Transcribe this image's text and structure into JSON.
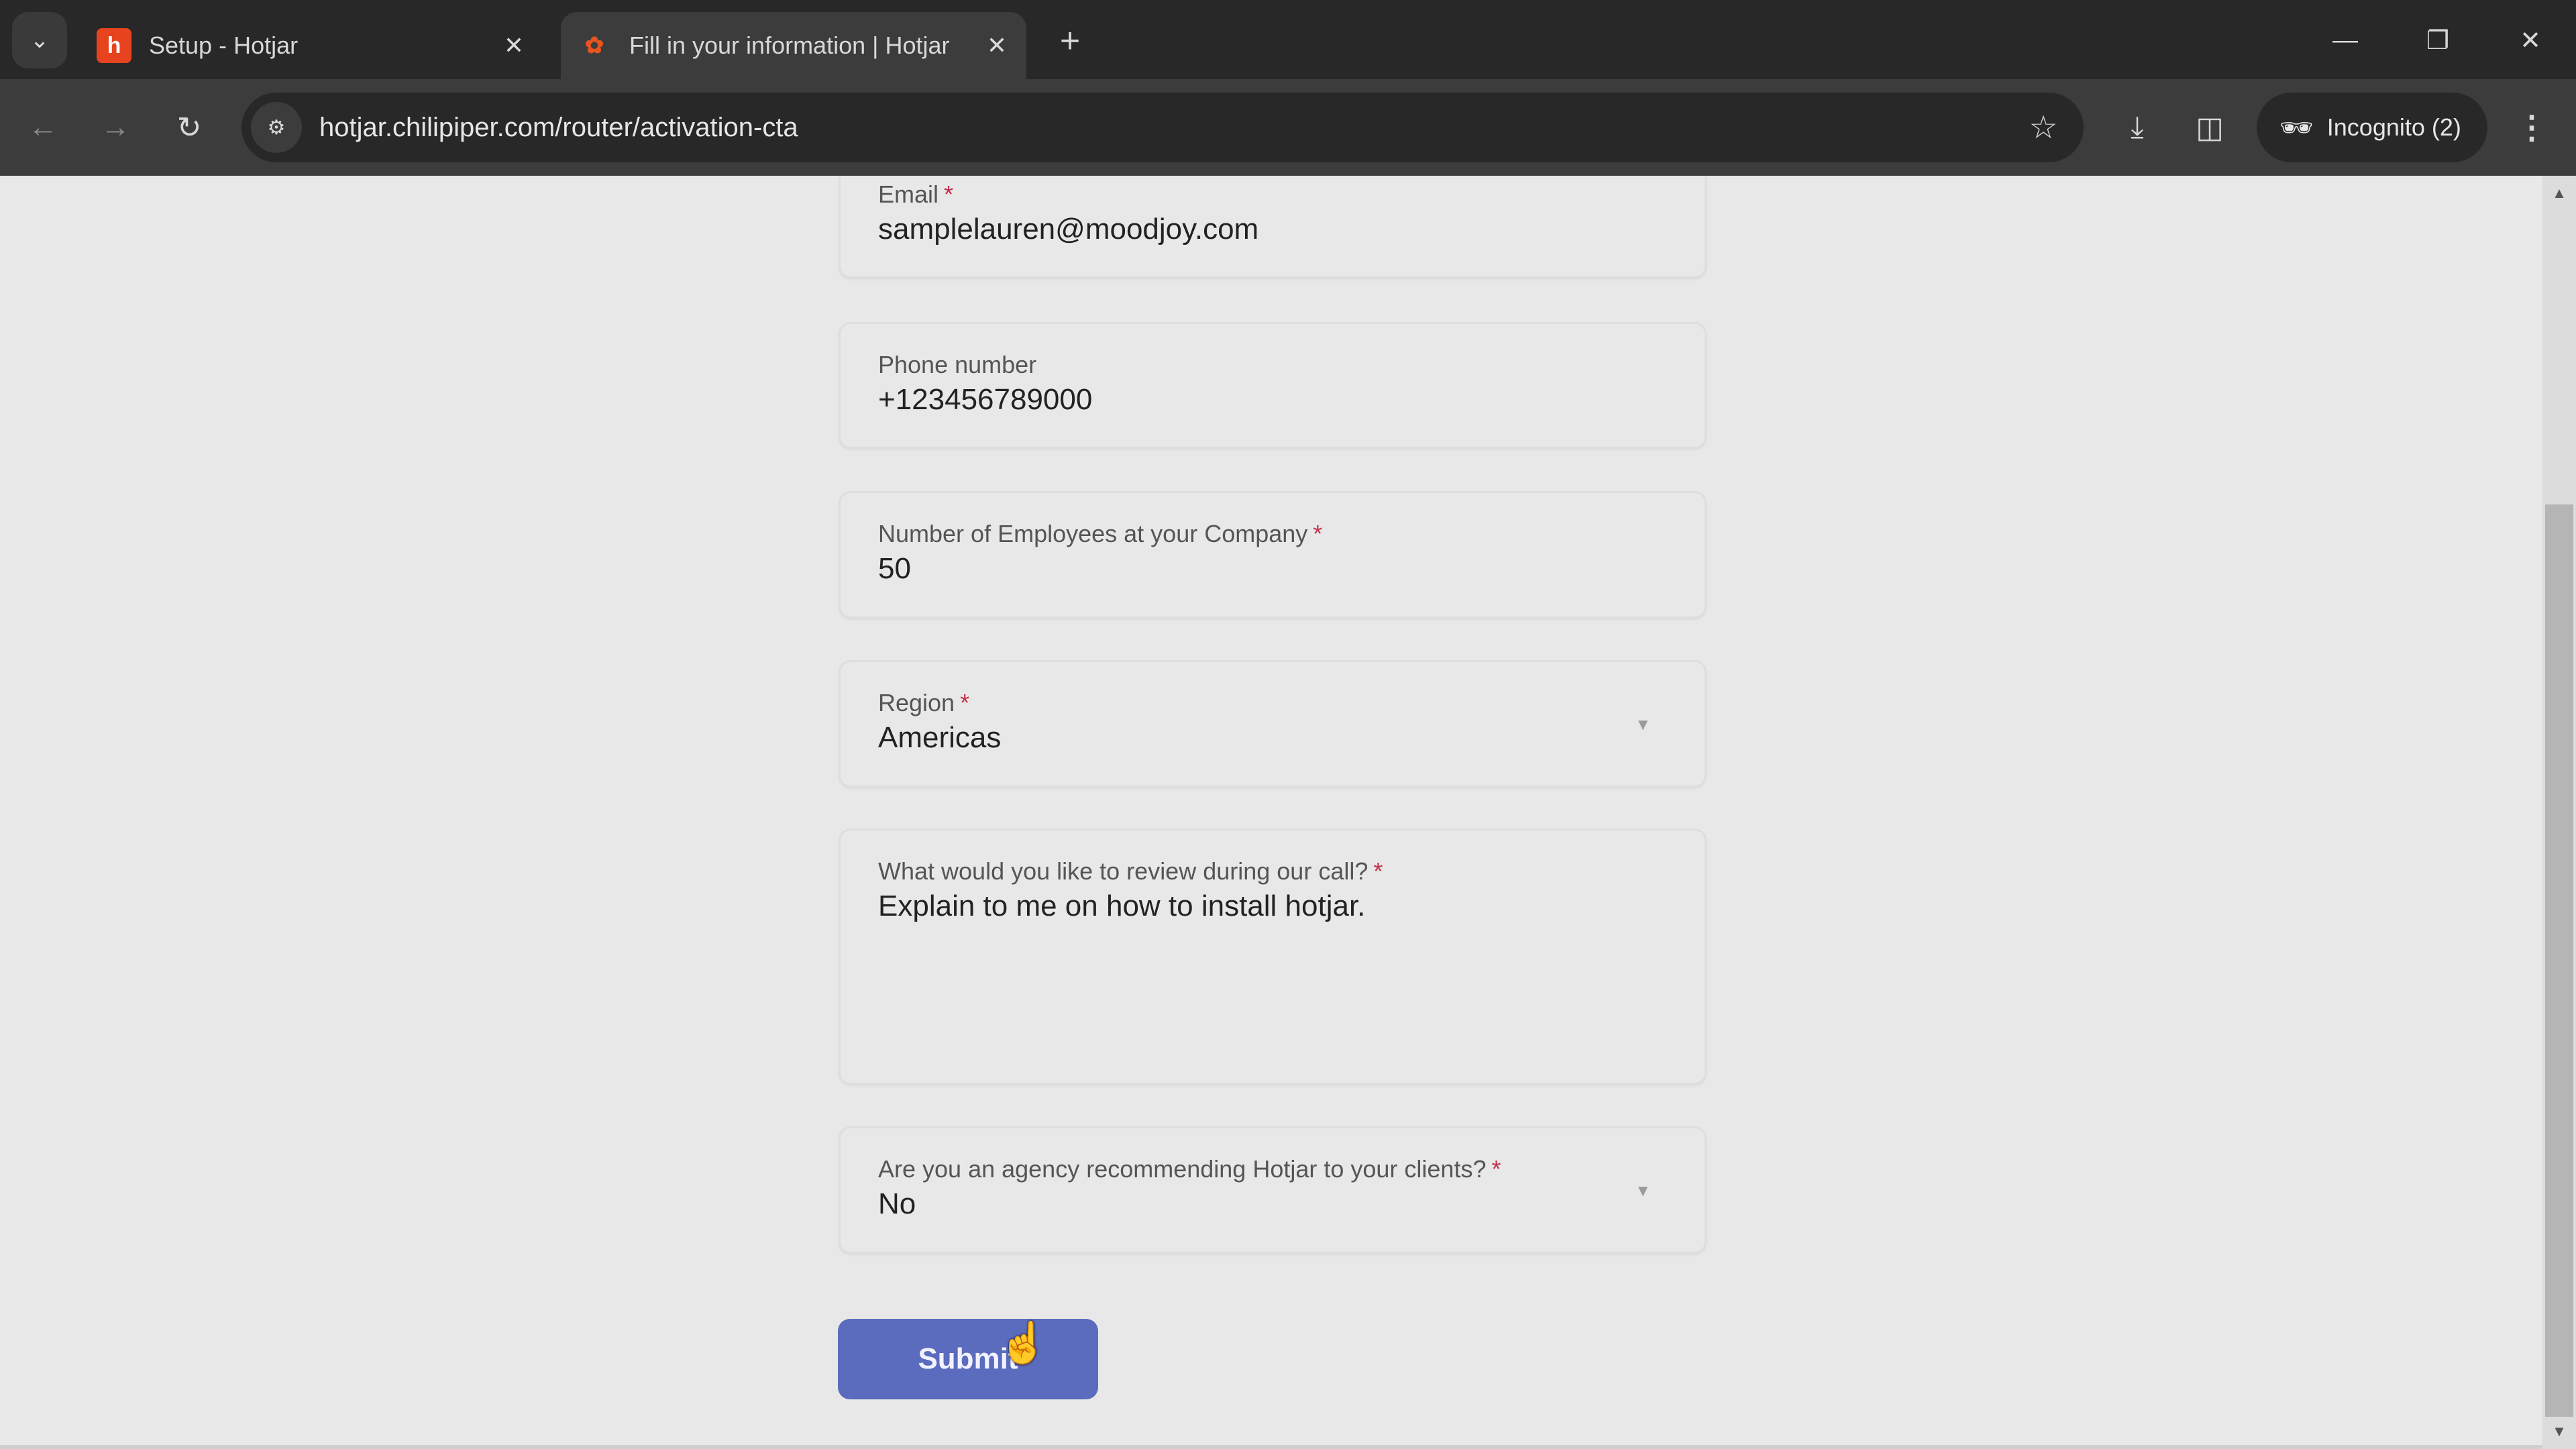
{
  "browser": {
    "tabs": [
      {
        "title": "Setup - Hotjar",
        "icon": "hotjar-logo-icon",
        "active": false
      },
      {
        "title": "Fill in your information | Hotjar",
        "icon": "chilipiper-logo-icon",
        "active": true
      }
    ],
    "tab_search_icon": "chevron-down-icon",
    "new_tab_icon": "plus-icon",
    "url": "hotjar.chilipiper.com/router/activation-cta",
    "incognito_label": "Incognito (2)",
    "window_controls": [
      "minimize",
      "restore",
      "close"
    ]
  },
  "form": {
    "fields": [
      {
        "label": "Email",
        "required": true,
        "value": "samplelauren@moodjoy.com",
        "type": "text"
      },
      {
        "label": "Phone number",
        "required": false,
        "value": "+123456789000",
        "type": "text"
      },
      {
        "label": "Number of Employees at your Company",
        "required": true,
        "value": "50",
        "type": "text"
      },
      {
        "label": "Region",
        "required": true,
        "value": "Americas",
        "type": "select"
      },
      {
        "label": "What would you like to review during our call?",
        "required": true,
        "value": "Explain to me on how to install hotjar.",
        "type": "textarea"
      },
      {
        "label": "Are you an agency recommending Hotjar to your clients?",
        "required": true,
        "value": "No",
        "type": "select"
      }
    ],
    "required_marker": "*",
    "submit_label": "Submit",
    "accent_color": "#5b6bbd",
    "required_color": "#c0304a"
  }
}
